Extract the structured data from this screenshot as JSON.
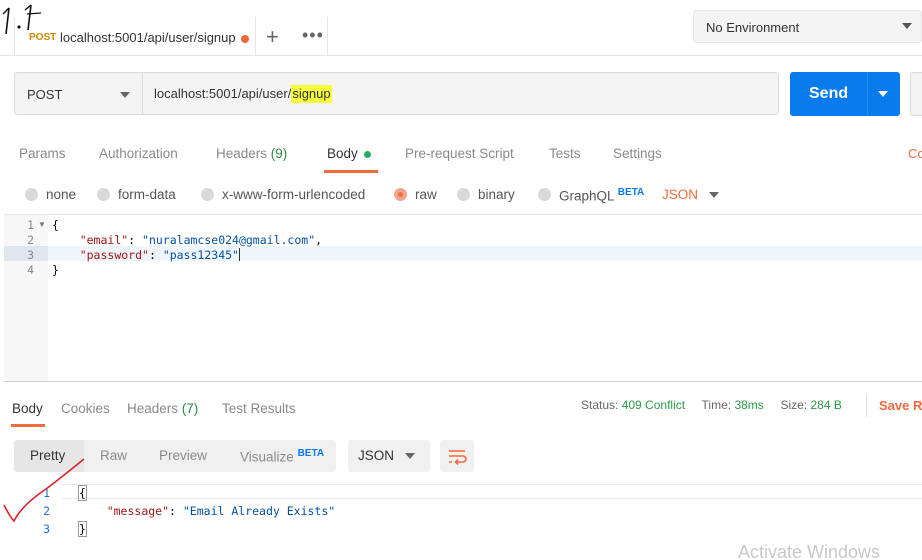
{
  "tab": {
    "method": "POST",
    "url": "localhost:5001/api/user/signup"
  },
  "tab_actions": {
    "plus": "+",
    "more": "•••"
  },
  "environment": {
    "selected": "No Environment"
  },
  "annotation": {
    "mark": "1.1"
  },
  "request": {
    "method": "POST",
    "url_prefix": "localhost:5001/api/user/",
    "url_highlight": "signup",
    "send_label": "Send"
  },
  "request_tabs": [
    {
      "label": "Params"
    },
    {
      "label": "Authorization"
    },
    {
      "label": "Headers",
      "count": "(9)"
    },
    {
      "label": "Body"
    },
    {
      "label": "Pre-request Script"
    },
    {
      "label": "Tests"
    },
    {
      "label": "Settings"
    }
  ],
  "cookies_link": "Co",
  "body_types": [
    {
      "label": "none",
      "selected": false
    },
    {
      "label": "form-data",
      "selected": false
    },
    {
      "label": "x-www-form-urlencoded",
      "selected": false
    },
    {
      "label": "raw",
      "selected": true
    },
    {
      "label": "binary",
      "selected": false
    },
    {
      "label": "GraphQL",
      "badge": "BETA",
      "selected": false
    }
  ],
  "body_format": "JSON",
  "request_body": {
    "line_numbers": [
      "1",
      "2",
      "3",
      "4"
    ],
    "open_brace": "{",
    "email_key": "\"email\"",
    "email_value": "\"nuralamcse024@gmail.com\"",
    "password_key": "\"password\"",
    "password_value": "\"pass12345\"",
    "close_brace": "}"
  },
  "response_tabs": [
    {
      "label": "Body"
    },
    {
      "label": "Cookies"
    },
    {
      "label": "Headers",
      "count": "(7)"
    },
    {
      "label": "Test Results"
    }
  ],
  "response_meta": {
    "status_label": "Status:",
    "status_value": "409 Conflict",
    "time_label": "Time:",
    "time_value": "38ms",
    "size_label": "Size:",
    "size_value": "284 B",
    "save_response": "Save R"
  },
  "response_view": {
    "modes": [
      "Pretty",
      "Raw",
      "Preview",
      "Visualize"
    ],
    "visualize_badge": "BETA",
    "active": "Pretty",
    "format": "JSON"
  },
  "response_body": {
    "line_numbers": [
      "1",
      "2",
      "3"
    ],
    "open_brace": "{",
    "message_key": "\"message\"",
    "message_value": "\"Email Already Exists\"",
    "close_brace": "}"
  },
  "watermark": "Activate Windows",
  "colors": {
    "accent": "#f26b3a",
    "send": "#097bed",
    "status_ok": "#2b9a48",
    "highlight": "#f6ff3c",
    "method_post": "#c88a00"
  }
}
